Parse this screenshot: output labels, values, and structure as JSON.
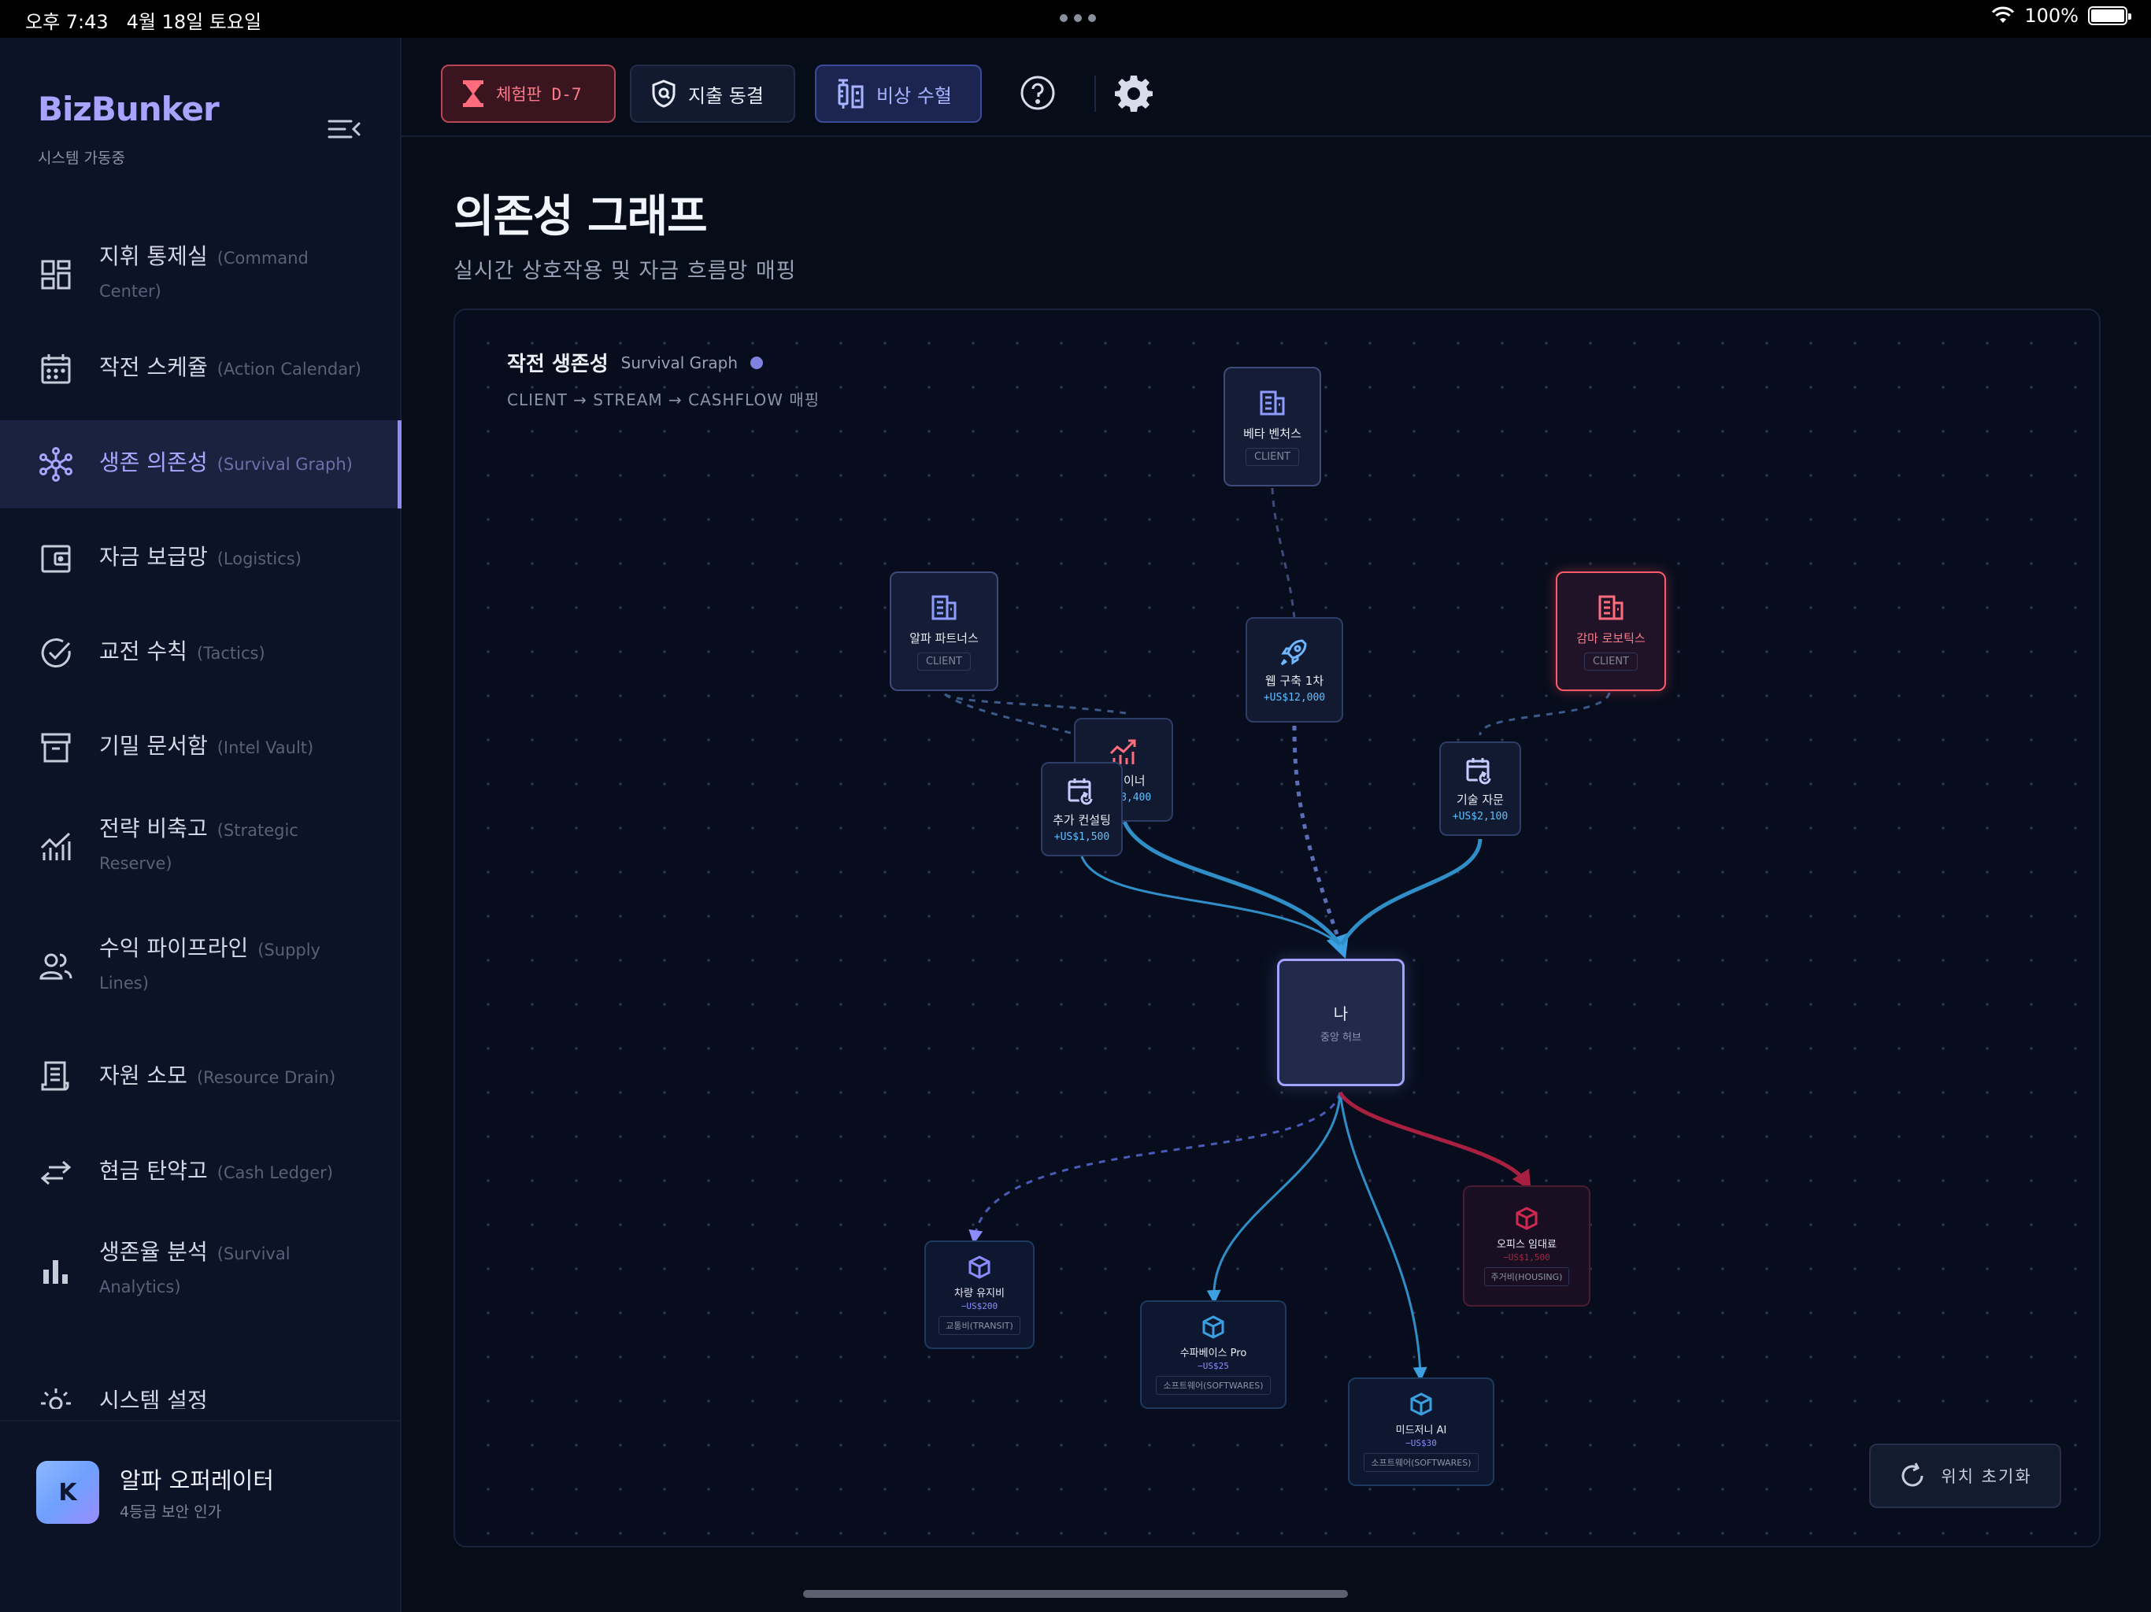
{
  "status_bar": {
    "time": "오후 7:43",
    "date": "4월 18일 토요일",
    "battery": "100%"
  },
  "sidebar": {
    "brand": "BizBunker",
    "brand_status": "시스템 가동중",
    "items": [
      {
        "ko": "지휘 통제실",
        "en": "(Command Center)",
        "icon": "dashboard-icon"
      },
      {
        "ko": "작전 스케쥴",
        "en": "(Action Calendar)",
        "icon": "calendar-icon"
      },
      {
        "ko": "생존 의존성",
        "en": "(Survival Graph)",
        "icon": "network-icon",
        "active": true
      },
      {
        "ko": "자금 보급망",
        "en": "(Logistics)",
        "icon": "wallet-icon"
      },
      {
        "ko": "교전 수칙",
        "en": "(Tactics)",
        "icon": "check-circle-icon"
      },
      {
        "ko": "기밀 문서함",
        "en": "(Intel Vault)",
        "icon": "archive-icon"
      },
      {
        "ko": "전략 비축고",
        "en": "(Strategic Reserve)",
        "icon": "growth-chart-icon"
      },
      {
        "ko": "수익 파이프라인",
        "en": "(Supply Lines)",
        "icon": "users-icon"
      },
      {
        "ko": "자원 소모",
        "en": "(Resource Drain)",
        "icon": "receipt-icon"
      },
      {
        "ko": "현금 탄약고",
        "en": "(Cash Ledger)",
        "icon": "transfer-icon"
      },
      {
        "ko": "생존율 분석",
        "en": "(Survival Analytics)",
        "icon": "bar-chart-icon"
      },
      {
        "ko": "시스템 설정",
        "en": "",
        "icon": "gear-icon"
      }
    ],
    "user": {
      "initial": "K",
      "name": "알파 오퍼레이터",
      "role": "4등급 보안 인가"
    }
  },
  "topbar": {
    "trial_label": "체험판 D-7",
    "freeze_label": "지출 동결",
    "transfusion_label": "비상 수혈"
  },
  "main": {
    "title": "의존성 그래프",
    "subtitle": "실시간 상호작용 및 자금 흐름망 매핑"
  },
  "graph": {
    "title_ko": "작전 생존성",
    "title_en": "Survival Graph",
    "subtitle": "CLIENT → STREAM → CASHFLOW 매핑",
    "clients": [
      {
        "id": "beta",
        "label": "베타 벤처스",
        "tag": "CLIENT",
        "danger": false
      },
      {
        "id": "alpha",
        "label": "알파 파트너스",
        "tag": "CLIENT",
        "danger": false
      },
      {
        "id": "gamma",
        "label": "감마 로보틱스",
        "tag": "CLIENT",
        "danger": true
      }
    ],
    "streams": [
      {
        "id": "web",
        "label": "웹 구축 1차",
        "amount": "+US$12,000"
      },
      {
        "id": "retainer",
        "label": "리테이너",
        "amount": "+US$8,400"
      },
      {
        "id": "consulting",
        "label": "추가 컨설팅",
        "amount": "+US$1,500"
      },
      {
        "id": "advisory",
        "label": "기술 자문",
        "amount": "+US$2,100"
      }
    ],
    "hub": {
      "label": "나",
      "sub": "중앙 허브"
    },
    "expenses": [
      {
        "id": "vehicle",
        "label": "차량 유지비",
        "amount": "−US$200",
        "category": "교통비(TRANSIT)",
        "danger": false
      },
      {
        "id": "supabase",
        "label": "수파베이스 Pro",
        "amount": "−US$25",
        "category": "소프트웨어(SOFTWARES)",
        "danger": false
      },
      {
        "id": "midjourney",
        "label": "미드저니 AI",
        "amount": "−US$30",
        "category": "소프트웨어(SOFTWARES)",
        "danger": false
      },
      {
        "id": "office",
        "label": "오피스 임대료",
        "amount": "−US$1,500",
        "category": "주거비(HOUSING)",
        "danger": true
      }
    ],
    "reset_label": "위치 초기화",
    "colors": {
      "accent": "#a4a2ff",
      "inflow": "#3aa0e0",
      "danger": "#ff5a68",
      "drain": "#a82040"
    }
  }
}
